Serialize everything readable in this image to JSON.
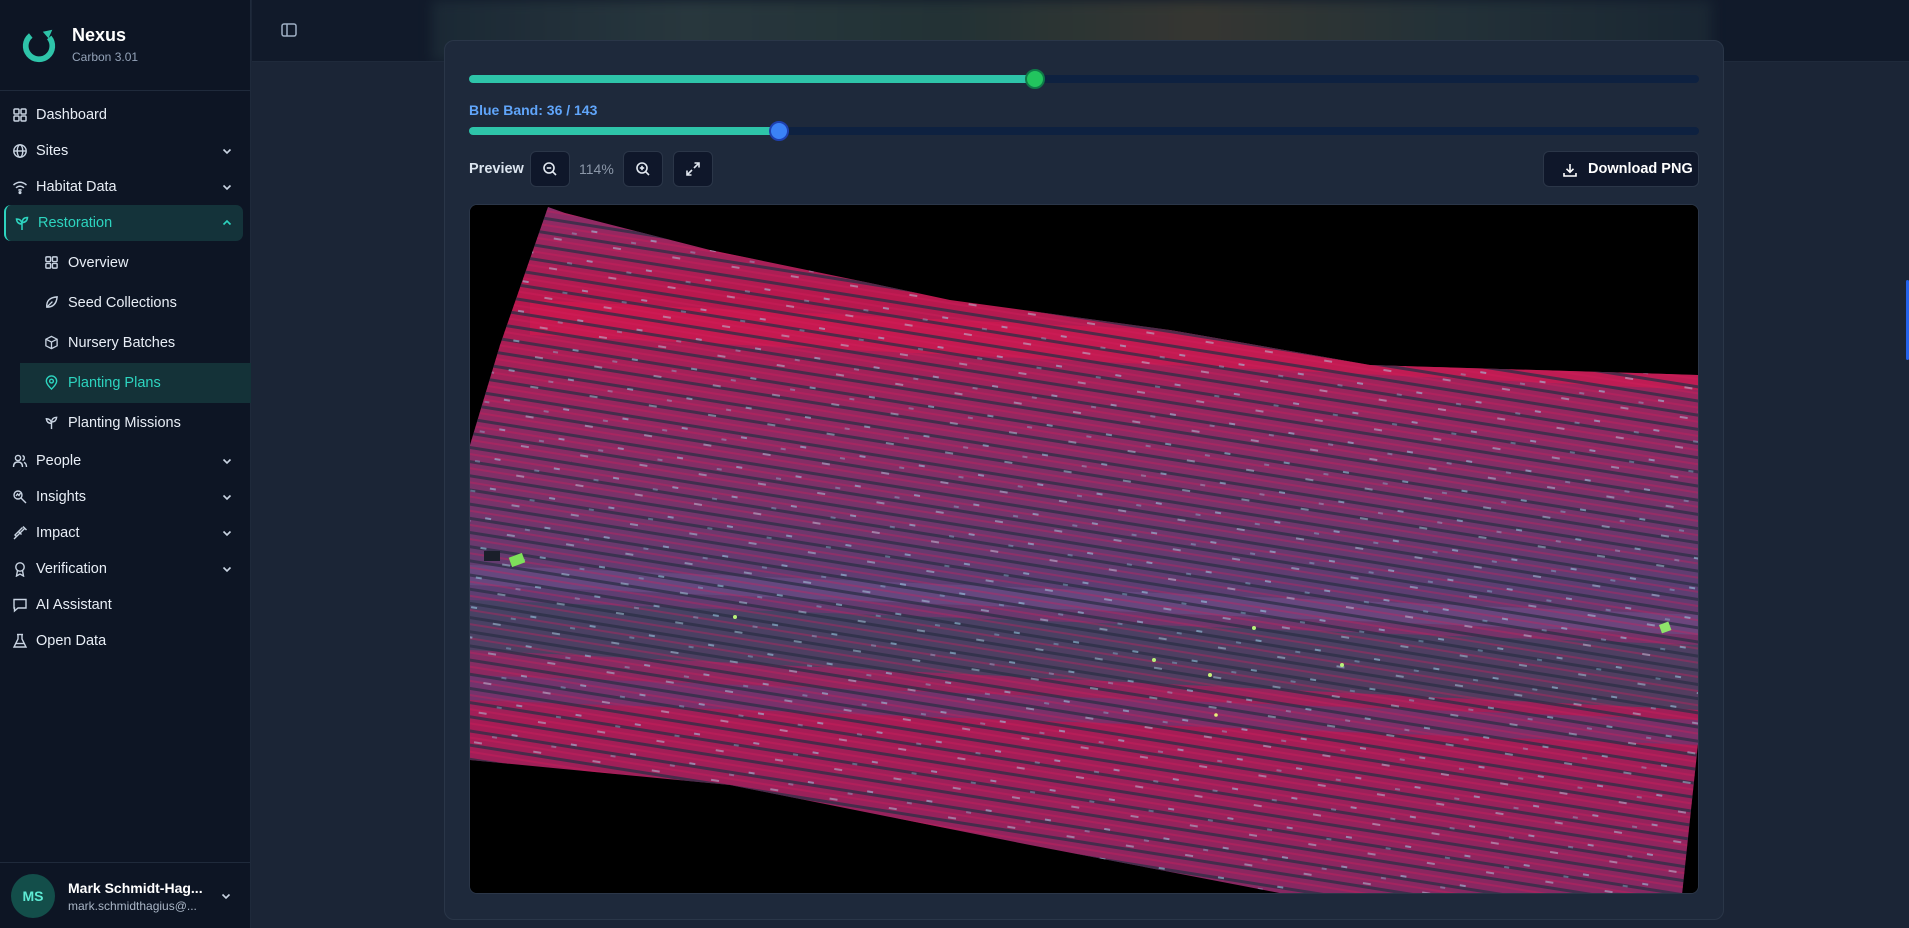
{
  "brand": {
    "name": "Nexus",
    "version": "Carbon 3.01"
  },
  "nav": {
    "dashboard": "Dashboard",
    "sites": "Sites",
    "habitat_data": "Habitat Data",
    "restoration": "Restoration",
    "restoration_sub": {
      "overview": "Overview",
      "seed_collections": "Seed Collections",
      "nursery_batches": "Nursery Batches",
      "planting_plans": "Planting Plans",
      "planting_missions": "Planting Missions"
    },
    "people": "People",
    "insights": "Insights",
    "impact": "Impact",
    "verification": "Verification",
    "ai_assistant": "AI Assistant",
    "open_data": "Open Data"
  },
  "user": {
    "initials": "MS",
    "name": "Mark Schmidt-Hag...",
    "email": "mark.schmidthagius@..."
  },
  "bands": {
    "green": {
      "value": 0.46
    },
    "blue": {
      "label": "Blue Band: 36 / 143",
      "value": 36,
      "max": 143
    }
  },
  "preview": {
    "label": "Preview",
    "zoom": "114%",
    "download_label": "Download PNG"
  },
  "colors": {
    "accent": "#2dd4bf",
    "blue": "#3b82f6",
    "green_thumb": "#22c55e"
  }
}
